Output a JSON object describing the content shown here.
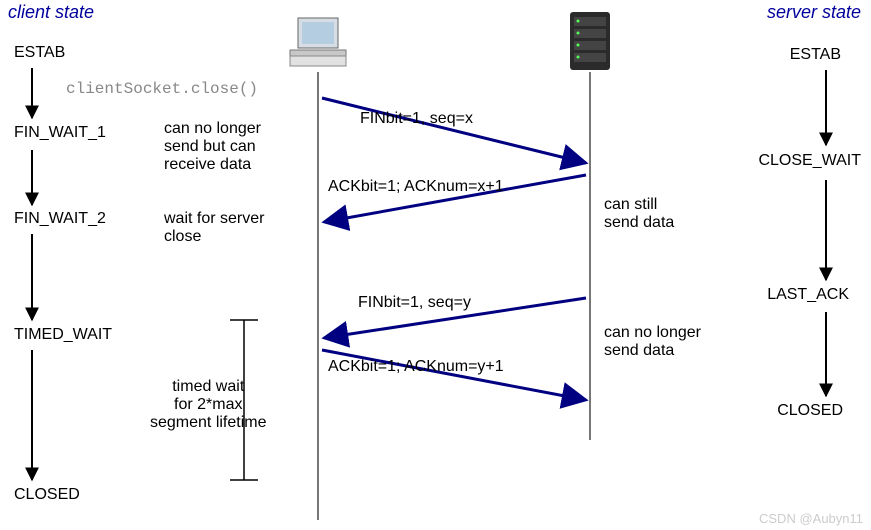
{
  "titles": {
    "client": "client state",
    "server": "server state"
  },
  "client_states": [
    "ESTAB",
    "FIN_WAIT_1",
    "FIN_WAIT_2",
    "TIMED_WAIT",
    "CLOSED"
  ],
  "server_states": [
    "ESTAB",
    "CLOSE_WAIT",
    "LAST_ACK",
    "CLOSED"
  ],
  "code": "clientSocket.close()",
  "notes": {
    "client_fw1": "can no longer\nsend but can\nreceive data",
    "client_fw2": "wait for server\nclose",
    "server_cw": "can still\nsend data",
    "server_la": "can no longer\nsend data",
    "timed_wait": "timed wait\nfor 2*max\nsegment lifetime"
  },
  "messages": {
    "m1": "FINbit=1, seq=x",
    "m2": "ACKbit=1; ACKnum=x+1",
    "m3": "FINbit=1, seq=y",
    "m4": "ACKbit=1; ACKnum=y+1"
  },
  "watermark": "CSDN @Aubyn11",
  "chart_data": {
    "type": "sequence-diagram",
    "title": "TCP connection close (four-way handshake)",
    "actors": [
      "client",
      "server"
    ],
    "events": [
      {
        "at": "client",
        "state": "ESTAB"
      },
      {
        "at": "server",
        "state": "ESTAB"
      },
      {
        "at": "client",
        "action": "clientSocket.close()"
      },
      {
        "from": "client",
        "to": "server",
        "label": "FINbit=1, seq=x"
      },
      {
        "at": "client",
        "state": "FIN_WAIT_1",
        "note": "can no longer send but can receive data"
      },
      {
        "at": "server",
        "state": "CLOSE_WAIT",
        "note": "can still send data"
      },
      {
        "from": "server",
        "to": "client",
        "label": "ACKbit=1; ACKnum=x+1"
      },
      {
        "at": "client",
        "state": "FIN_WAIT_2",
        "note": "wait for server close"
      },
      {
        "from": "server",
        "to": "client",
        "label": "FINbit=1, seq=y"
      },
      {
        "at": "server",
        "state": "LAST_ACK",
        "note": "can no longer send data"
      },
      {
        "at": "client",
        "state": "TIMED_WAIT",
        "note": "timed wait for 2*max segment lifetime"
      },
      {
        "from": "client",
        "to": "server",
        "label": "ACKbit=1; ACKnum=y+1"
      },
      {
        "at": "server",
        "state": "CLOSED"
      },
      {
        "at": "client",
        "state": "CLOSED"
      }
    ]
  }
}
